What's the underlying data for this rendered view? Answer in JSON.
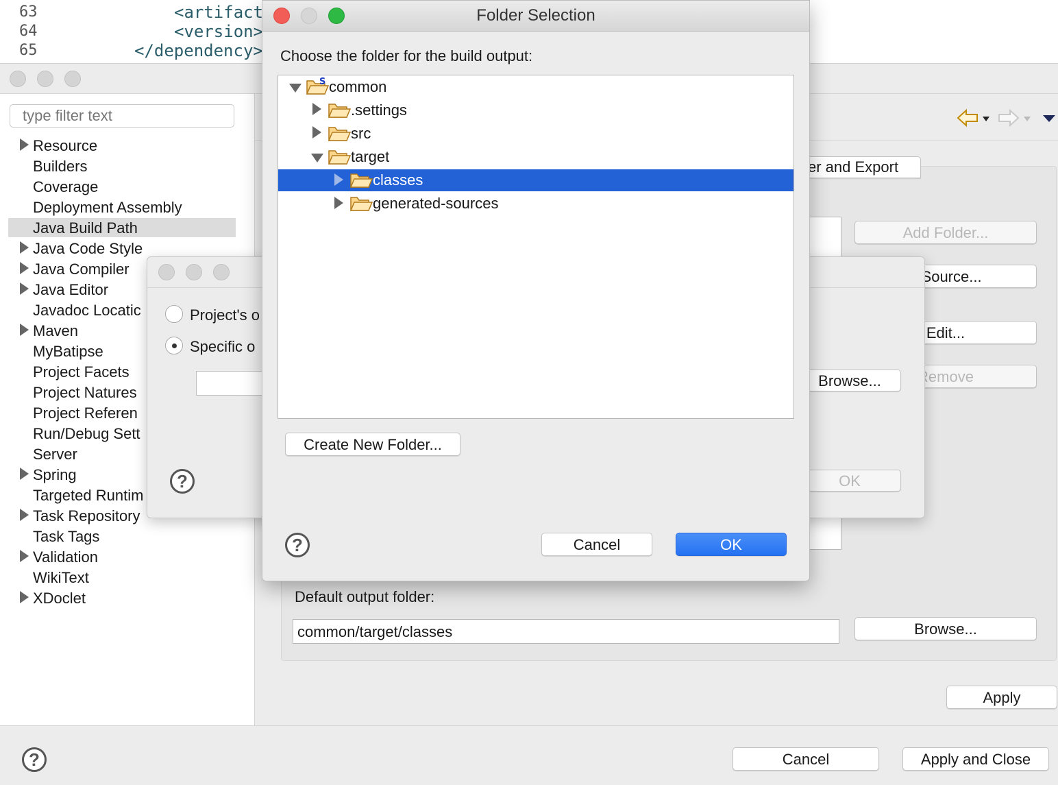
{
  "editor": {
    "lines": [
      {
        "num": "63",
        "code": "<artifact"
      },
      {
        "num": "64",
        "code": "<version>"
      },
      {
        "num": "65",
        "code": "</dependency>"
      }
    ]
  },
  "properties": {
    "filter_placeholder": "type filter text",
    "nav_items": [
      {
        "label": "Resource",
        "expandable": true
      },
      {
        "label": "Builders",
        "expandable": false
      },
      {
        "label": "Coverage",
        "expandable": false
      },
      {
        "label": "Deployment Assembly",
        "expandable": false
      },
      {
        "label": "Java Build Path",
        "expandable": false,
        "selected": true
      },
      {
        "label": "Java Code Style",
        "expandable": true
      },
      {
        "label": "Java Compiler",
        "expandable": true
      },
      {
        "label": "Java Editor",
        "expandable": true
      },
      {
        "label": "Javadoc Locatic",
        "expandable": false
      },
      {
        "label": "Maven",
        "expandable": true
      },
      {
        "label": "MyBatipse",
        "expandable": false
      },
      {
        "label": "Project Facets",
        "expandable": false
      },
      {
        "label": "Project Natures",
        "expandable": false
      },
      {
        "label": "Project Referen",
        "expandable": false
      },
      {
        "label": "Run/Debug Sett",
        "expandable": false
      },
      {
        "label": "Server",
        "expandable": false
      },
      {
        "label": "Spring",
        "expandable": true
      },
      {
        "label": "Targeted Runtim",
        "expandable": false
      },
      {
        "label": "Task Repository",
        "expandable": true
      },
      {
        "label": "Task Tags",
        "expandable": false
      },
      {
        "label": "Validation",
        "expandable": true
      },
      {
        "label": "WikiText",
        "expandable": false
      },
      {
        "label": "XDoclet",
        "expandable": true
      }
    ],
    "tab_order_export": "er and Export",
    "add_folder": "Add Folder...",
    "link_source": "k Source...",
    "edit": "Edit...",
    "remove": "Remove",
    "default_output_label": "Default output folder:",
    "default_output_value": "common/target/classes",
    "browse": "Browse...",
    "apply": "Apply",
    "cancel": "Cancel",
    "apply_close": "Apply and Close"
  },
  "output_dialog": {
    "option_project": "Project's o",
    "option_specific": "Specific o",
    "browse": "Browse...",
    "ok": "OK"
  },
  "folder_dialog": {
    "title": "Folder Selection",
    "prompt": "Choose the folder for the build output:",
    "tree": {
      "root": "common",
      "settings": ".settings",
      "src": "src",
      "target": "target",
      "classes": "classes",
      "generated": "generated-sources"
    },
    "create_folder": "Create New Folder...",
    "cancel": "Cancel",
    "ok": "OK"
  },
  "colors": {
    "selection": "#2362d6",
    "ok_button": "#2f7cf6",
    "code_text": "#2a5d6a",
    "close_red": "#f25e57",
    "zoom_green": "#2eb844"
  }
}
